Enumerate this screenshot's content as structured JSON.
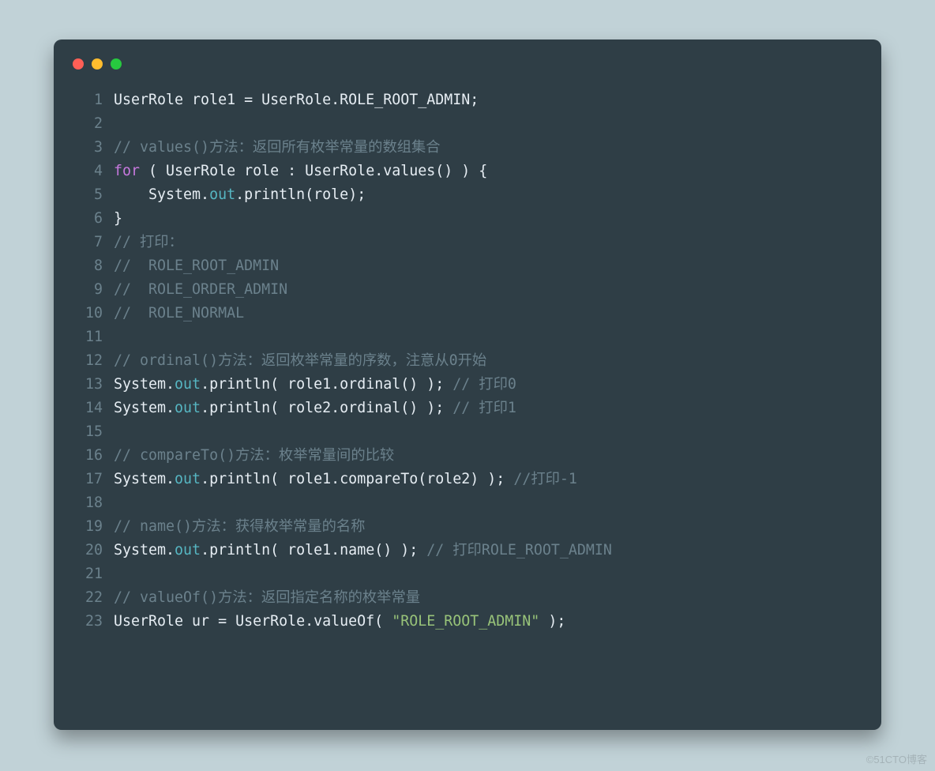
{
  "watermark": "©51CTO博客",
  "code": {
    "lines": [
      {
        "n": "1",
        "tokens": [
          {
            "t": "UserRole role1 = UserRole.ROLE_ROOT_ADMIN;"
          }
        ]
      },
      {
        "n": "2",
        "tokens": []
      },
      {
        "n": "3",
        "tokens": [
          {
            "t": "// values()方法：返回所有枚举常量的数组集合",
            "cls": "c-comment"
          }
        ]
      },
      {
        "n": "4",
        "tokens": [
          {
            "t": "for",
            "cls": "c-keyword"
          },
          {
            "t": " ( UserRole role : UserRole.values() ) {"
          }
        ]
      },
      {
        "n": "5",
        "tokens": [
          {
            "t": "    System."
          },
          {
            "t": "out",
            "cls": "c-out"
          },
          {
            "t": ".println(role);"
          }
        ]
      },
      {
        "n": "6",
        "tokens": [
          {
            "t": "}"
          }
        ]
      },
      {
        "n": "7",
        "tokens": [
          {
            "t": "// 打印：",
            "cls": "c-comment"
          }
        ]
      },
      {
        "n": "8",
        "tokens": [
          {
            "t": "//  ROLE_ROOT_ADMIN",
            "cls": "c-comment"
          }
        ]
      },
      {
        "n": "9",
        "tokens": [
          {
            "t": "//  ROLE_ORDER_ADMIN",
            "cls": "c-comment"
          }
        ]
      },
      {
        "n": "10",
        "tokens": [
          {
            "t": "//  ROLE_NORMAL",
            "cls": "c-comment"
          }
        ]
      },
      {
        "n": "11",
        "tokens": []
      },
      {
        "n": "12",
        "tokens": [
          {
            "t": "// ordinal()方法：返回枚举常量的序数，注意从0开始",
            "cls": "c-comment"
          }
        ]
      },
      {
        "n": "13",
        "tokens": [
          {
            "t": "System."
          },
          {
            "t": "out",
            "cls": "c-out"
          },
          {
            "t": ".println( role1.ordinal() ); "
          },
          {
            "t": "// 打印0",
            "cls": "c-comment"
          }
        ]
      },
      {
        "n": "14",
        "tokens": [
          {
            "t": "System."
          },
          {
            "t": "out",
            "cls": "c-out"
          },
          {
            "t": ".println( role2.ordinal() ); "
          },
          {
            "t": "// 打印1",
            "cls": "c-comment"
          }
        ]
      },
      {
        "n": "15",
        "tokens": []
      },
      {
        "n": "16",
        "tokens": [
          {
            "t": "// compareTo()方法：枚举常量间的比较",
            "cls": "c-comment"
          }
        ]
      },
      {
        "n": "17",
        "tokens": [
          {
            "t": "System."
          },
          {
            "t": "out",
            "cls": "c-out"
          },
          {
            "t": ".println( role1.compareTo(role2) ); "
          },
          {
            "t": "//打印-1",
            "cls": "c-comment"
          }
        ]
      },
      {
        "n": "18",
        "tokens": []
      },
      {
        "n": "19",
        "tokens": [
          {
            "t": "// name()方法：获得枚举常量的名称",
            "cls": "c-comment"
          }
        ]
      },
      {
        "n": "20",
        "tokens": [
          {
            "t": "System."
          },
          {
            "t": "out",
            "cls": "c-out"
          },
          {
            "t": ".println( role1.name() ); "
          },
          {
            "t": "// 打印ROLE_ROOT_ADMIN",
            "cls": "c-comment"
          }
        ]
      },
      {
        "n": "21",
        "tokens": []
      },
      {
        "n": "22",
        "tokens": [
          {
            "t": "// valueOf()方法：返回指定名称的枚举常量",
            "cls": "c-comment"
          }
        ]
      },
      {
        "n": "23",
        "tokens": [
          {
            "t": "UserRole ur = UserRole.valueOf( "
          },
          {
            "t": "\"ROLE_ROOT_ADMIN\"",
            "cls": "c-string"
          },
          {
            "t": " );"
          }
        ]
      }
    ]
  }
}
